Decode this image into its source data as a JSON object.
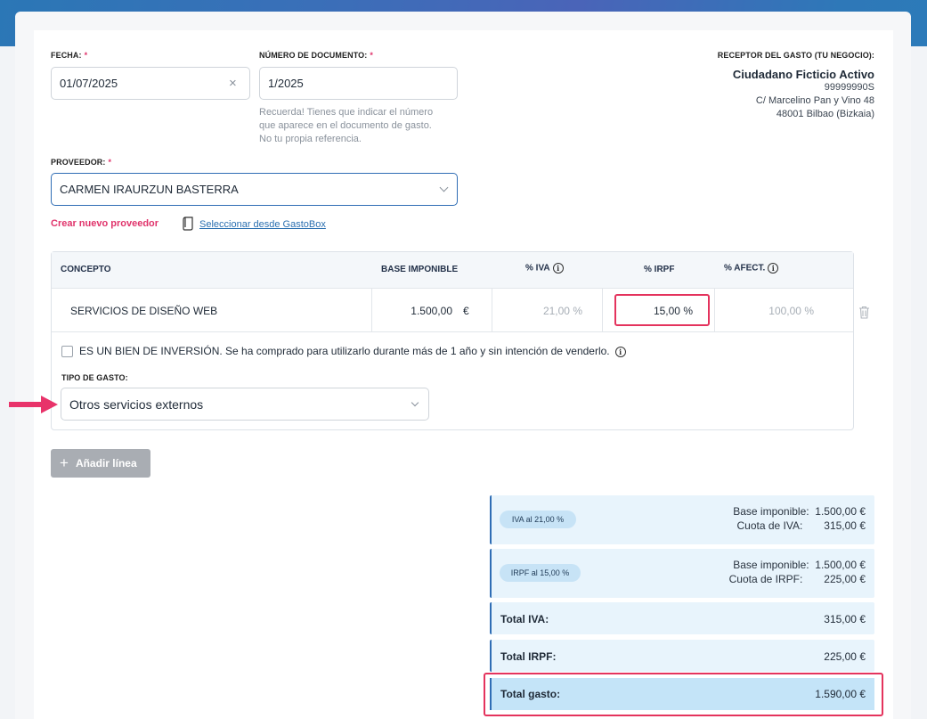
{
  "form": {
    "fecha": {
      "label": "FECHA:",
      "required": "*",
      "value": "01/07/2025"
    },
    "numero": {
      "label": "NÚMERO DE DOCUMENTO:",
      "required": "*",
      "value": "1/2025",
      "hint_1": "Recuerda! Tienes que indicar el número",
      "hint_2": "que aparece en el documento de gasto.",
      "hint_3": "No tu propia referencia."
    },
    "receptor": {
      "label": "RECEPTOR DEL GASTO (TU NEGOCIO):",
      "name": "Ciudadano Ficticio Activo",
      "nif": "99999990S",
      "address": "C/ Marcelino Pan y Vino 48",
      "city": "48001 Bilbao (Bizkaia)"
    },
    "proveedor": {
      "label": "PROVEEDOR:",
      "required": "*",
      "value": "CARMEN IRAURZUN BASTERRA",
      "create_link": "Crear nuevo proveedor",
      "select_link": "Seleccionar desde GastoBox"
    }
  },
  "table": {
    "headers": {
      "concepto": "CONCEPTO",
      "base": "BASE IMPONIBLE",
      "iva": "% IVA",
      "irpf": "% IRPF",
      "afect": "% AFECT."
    },
    "row": {
      "concepto": "SERVICIOS DE DISEÑO WEB",
      "base": "1.500,00",
      "base_currency": "€",
      "iva": "21,00 %",
      "irpf": "15,00 %",
      "afect": "100,00 %"
    },
    "inversion_text": "ES UN BIEN DE INVERSIÓN. Se ha comprado para utilizarlo durante más de 1 año y sin intención de venderlo.",
    "tipo_gasto": {
      "label": "TIPO DE GASTO:",
      "value": "Otros servicios externos"
    }
  },
  "add_line_label": "Añadir línea",
  "summary": {
    "iva_box": {
      "pill": "IVA al 21,00 %",
      "base_label": "Base imponible:",
      "base_value": "1.500,00 €",
      "cuota_label": "Cuota de IVA:",
      "cuota_value": "315,00 €"
    },
    "irpf_box": {
      "pill": "IRPF al 15,00 %",
      "base_label": "Base imponible:",
      "base_value": "1.500,00 €",
      "cuota_label": "Cuota de IRPF:",
      "cuota_value": "225,00 €"
    },
    "total_iva": {
      "label": "Total IVA:",
      "value": "315,00 €"
    },
    "total_irpf": {
      "label": "Total IRPF:",
      "value": "225,00 €"
    },
    "total_gasto": {
      "label": "Total gasto:",
      "value": "1.590,00 €"
    }
  },
  "colors": {
    "accent_blue": "#2f6db5",
    "highlight_pink": "#e4335d",
    "summary_bg": "#e8f4fc",
    "total_bg": "#c4e4f8"
  }
}
